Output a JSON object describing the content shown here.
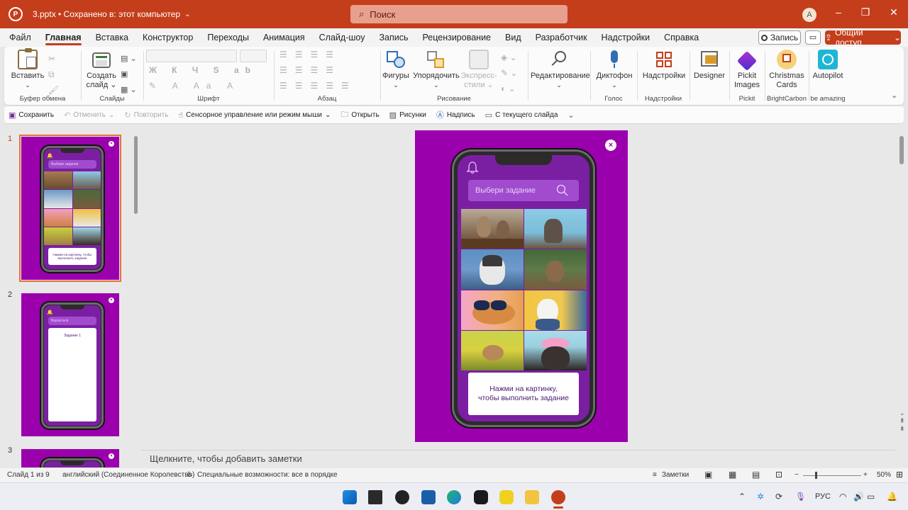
{
  "titlebar": {
    "logo": "P",
    "doc_title": "3.pptx • Сохранено в: этот компьютер",
    "search_placeholder": "Поиск",
    "avatar_letter": "A"
  },
  "menu": {
    "tabs": [
      "Файл",
      "Главная",
      "Вставка",
      "Конструктор",
      "Переходы",
      "Анимация",
      "Слайд-шоу",
      "Запись",
      "Рецензирование",
      "Вид",
      "Разработчик",
      "Надстройки",
      "Справка"
    ],
    "active_index": 1,
    "record_label": "Запись",
    "share_label": "Общий доступ"
  },
  "ribbon": {
    "clipboard": {
      "paste": "Вставить",
      "group": "Буфер обмена"
    },
    "slides": {
      "new_slide_1": "Создать",
      "new_slide_2": "слайд",
      "group": "Слайды"
    },
    "font": {
      "group": "Шрифт",
      "styles": "Ж К Ч S ab"
    },
    "paragraph": {
      "group": "Абзац"
    },
    "drawing": {
      "shapes": "Фигуры",
      "arrange": "Упорядочить",
      "quick_styles_1": "Экспресс-",
      "quick_styles_2": "стили",
      "group": "Рисование"
    },
    "editing": {
      "label": "Редактирование"
    },
    "voice": {
      "dictate": "Диктофон",
      "group": "Голос"
    },
    "addins": {
      "label": "Надстройки",
      "group": "Надстройки"
    },
    "designer": {
      "label": "Designer"
    },
    "pickit": {
      "label_1": "Pickit",
      "label_2": "Images",
      "group": "Pickit"
    },
    "christmas": {
      "label_1": "Christmas",
      "label_2": "Cards",
      "group": "BrightCarbon"
    },
    "autopilot": {
      "label": "Autopilot",
      "group": "be amazing"
    }
  },
  "qat": {
    "save": "Сохранить",
    "undo": "Отменить",
    "redo": "Повторить",
    "touch_mode": "Сенсорное управление или режим мыши",
    "open": "Открыть",
    "pictures": "Рисунки",
    "textbox": "Надпись",
    "from_current": "С текущего слайда"
  },
  "thumbnails": [
    {
      "num": "1",
      "search": "Выбери задание",
      "card": "Нажми на картинку, чтобы выполнить задание"
    },
    {
      "num": "2",
      "search": "Вернуться",
      "card": "Задание 1"
    },
    {
      "num": "3"
    }
  ],
  "slide": {
    "search_text": "Выбери задание",
    "card_line_1": "Нажми на картинку,",
    "card_line_2": "чтобы выполнить задание",
    "close_glyph": "×",
    "photos": [
      "rabbits-photo",
      "cat-photo",
      "husky-photo",
      "squirrel-photo",
      "guinea-pig-photo",
      "westie-photo",
      "hamster-photo",
      "shih-tzu-photo"
    ]
  },
  "notes_placeholder": "Щелкните, чтобы добавить заметки",
  "status": {
    "slide_count": "Слайд 1 из 9",
    "language": "английский (Соединенное Королевство)",
    "accessibility": "Специальные возможности: все в порядке",
    "notes": "Заметки",
    "zoom": "50%"
  },
  "taskbar": {
    "lang": "РУС"
  },
  "colors": {
    "accent": "#c43e1c",
    "slide_bg": "#9b00ad"
  }
}
